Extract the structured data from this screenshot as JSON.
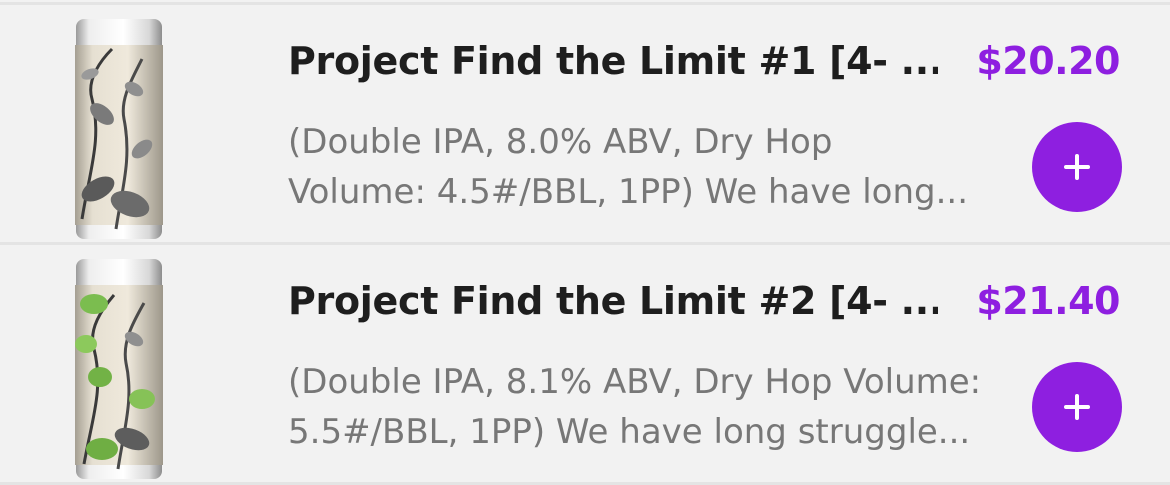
{
  "colors": {
    "accent": "#8e1fe0",
    "title": "#1e1e1e",
    "description": "#777777",
    "background": "#f2f2f2"
  },
  "products": [
    {
      "name": "Project Find the Limit #1 [4- ...",
      "price": "$20.20",
      "description_line1": "(Double IPA, 8.0% ABV, Dry Hop",
      "description_line2": "Volume: 4.5#/BBL, 1PP) We have long...",
      "image_icon": "beer-can-hops-grayscale",
      "add_icon": "plus-icon"
    },
    {
      "name": "Project Find the Limit #2 [4- ...",
      "price": "$21.40",
      "description_line1": "(Double IPA, 8.1% ABV, Dry Hop Volume:",
      "description_line2": "5.5#/BBL, 1PP) We have long struggle...",
      "image_icon": "beer-can-hops-green",
      "add_icon": "plus-icon"
    }
  ]
}
